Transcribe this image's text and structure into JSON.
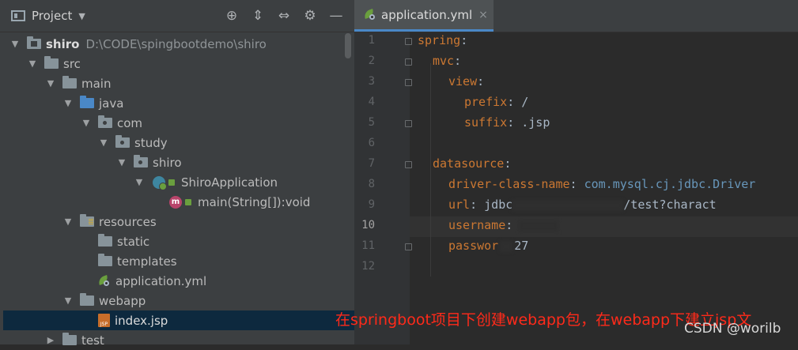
{
  "project_panel": {
    "title": "Project",
    "tools": [
      "target-icon",
      "expand-all-icon",
      "collapse-all-icon",
      "gear-icon",
      "minimize-icon"
    ],
    "tree": [
      {
        "label": "shiro",
        "path": "D:\\CODE\\spingbootdemo\\shiro",
        "icon": "module-folder-icon",
        "expanded": true
      },
      {
        "label": "src",
        "icon": "folder-icon",
        "expanded": true
      },
      {
        "label": "main",
        "icon": "folder-icon",
        "expanded": true
      },
      {
        "label": "java",
        "icon": "source-folder-icon",
        "expanded": true
      },
      {
        "label": "com",
        "icon": "package-icon",
        "expanded": true
      },
      {
        "label": "study",
        "icon": "package-icon",
        "expanded": true
      },
      {
        "label": "shiro",
        "icon": "package-icon",
        "expanded": true
      },
      {
        "label": "ShiroApplication",
        "icon": "spring-class-icon",
        "expanded": true
      },
      {
        "label": "main(String[]):void",
        "icon": "method-icon"
      },
      {
        "label": "resources",
        "icon": "resources-folder-icon",
        "expanded": true
      },
      {
        "label": "static",
        "icon": "folder-icon"
      },
      {
        "label": "templates",
        "icon": "folder-icon"
      },
      {
        "label": "application.yml",
        "icon": "spring-config-icon"
      },
      {
        "label": "webapp",
        "icon": "folder-icon",
        "expanded": true
      },
      {
        "label": "index.jsp",
        "icon": "jsp-file-icon",
        "selected": true
      },
      {
        "label": "test",
        "icon": "folder-icon",
        "expanded": false
      }
    ]
  },
  "editor": {
    "tab": {
      "label": "application.yml",
      "close": "×"
    },
    "active_line": 10,
    "lines": [
      {
        "n": "1",
        "key": "spring",
        "sep": ":",
        "value": ""
      },
      {
        "n": "2",
        "key": "mvc",
        "sep": ":",
        "value": ""
      },
      {
        "n": "3",
        "key": "view",
        "sep": ":",
        "value": ""
      },
      {
        "n": "4",
        "key": "prefix",
        "sep": ":",
        "value": " /"
      },
      {
        "n": "5",
        "key": "suffix",
        "sep": ":",
        "value": " .jsp"
      },
      {
        "n": "6",
        "key": "",
        "sep": "",
        "value": ""
      },
      {
        "n": "7",
        "key": "datasource",
        "sep": ":",
        "value": ""
      },
      {
        "n": "8",
        "key": "driver-class-name",
        "sep": ":",
        "value": " com.mysql.cj.jdbc.Driver"
      },
      {
        "n": "9",
        "key": "url",
        "sep": ":",
        "value": " jdbc",
        "value_tail": "/test?charact"
      },
      {
        "n": "10",
        "key": "username",
        "sep": ":",
        "value": ""
      },
      {
        "n": "11",
        "key": "passwor",
        "sep": "",
        "value": "27"
      },
      {
        "n": "12",
        "key": "",
        "sep": "",
        "value": ""
      }
    ]
  },
  "annotation": "在springboot项目下创建webapp包，在webapp下建立jsp文",
  "watermark": "CSDN @worilb",
  "colors": {
    "keyword": "#cc7832",
    "value": "#a9b7c6",
    "annotation": "#ff2a1a",
    "selection": "#0d293e"
  }
}
